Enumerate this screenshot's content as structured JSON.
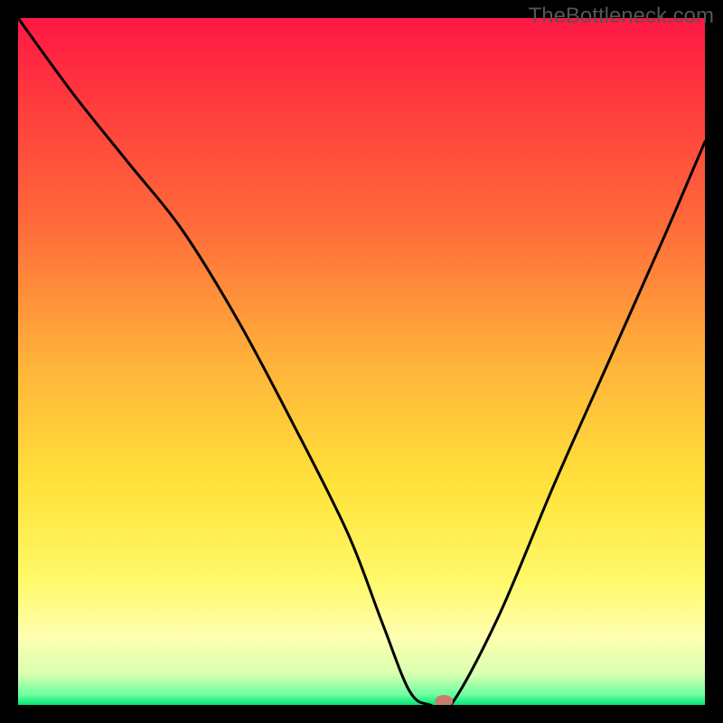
{
  "watermark": "TheBottleneck.com",
  "chart_data": {
    "type": "line",
    "title": "",
    "xlabel": "",
    "ylabel": "",
    "xlim": [
      0,
      100
    ],
    "ylim": [
      0,
      100
    ],
    "series": [
      {
        "name": "curve",
        "x": [
          0,
          8,
          16,
          24,
          32,
          40,
          48,
          53,
          57,
          60,
          63,
          70,
          78,
          86,
          94,
          100
        ],
        "y": [
          100,
          89,
          79,
          69,
          56,
          41,
          25,
          12,
          2,
          0,
          0,
          13,
          32,
          50,
          68,
          82
        ]
      }
    ],
    "marker": {
      "x": 62,
      "y": 0,
      "color": "#c97c6e"
    },
    "background_gradient": {
      "stops": [
        {
          "offset": 0.0,
          "color": "#ff1744"
        },
        {
          "offset": 0.12,
          "color": "#ff3a3e"
        },
        {
          "offset": 0.3,
          "color": "#ff6a3a"
        },
        {
          "offset": 0.5,
          "color": "#ffb23a"
        },
        {
          "offset": 0.68,
          "color": "#ffe23a"
        },
        {
          "offset": 0.82,
          "color": "#fff96a"
        },
        {
          "offset": 0.9,
          "color": "#ffffb0"
        },
        {
          "offset": 0.955,
          "color": "#d9ffb0"
        },
        {
          "offset": 0.985,
          "color": "#6effa0"
        },
        {
          "offset": 1.0,
          "color": "#00e676"
        }
      ]
    }
  }
}
